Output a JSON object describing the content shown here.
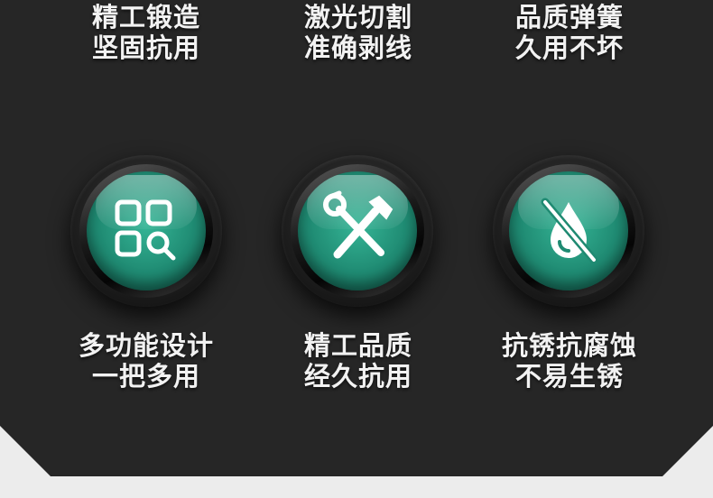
{
  "top_features": [
    {
      "line1": "精工锻造",
      "line2": "坚固抗用"
    },
    {
      "line1": "激光切割",
      "line2": "准确剥线"
    },
    {
      "line1": "品质弹簧",
      "line2": "久用不坏"
    }
  ],
  "features": [
    {
      "icon": "grid-search-icon",
      "line1": "多功能设计",
      "line2": "一把多用"
    },
    {
      "icon": "wrench-screwdriver-icon",
      "line1": "精工品质",
      "line2": "经久抗用"
    },
    {
      "icon": "no-water-drop-icon",
      "line1": "抗锈抗腐蚀",
      "line2": "不易生锈"
    }
  ],
  "colors": {
    "panel": "#262626",
    "accent": "#1f8a72",
    "text": "#f2f2f2",
    "background": "#ececec"
  }
}
